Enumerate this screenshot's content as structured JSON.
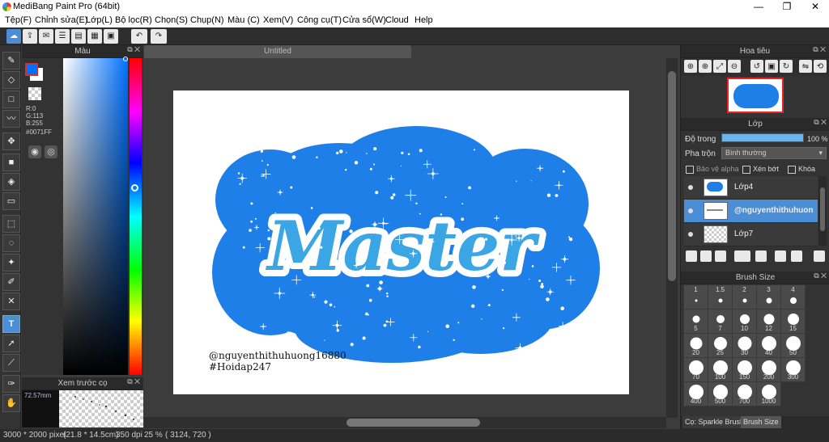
{
  "window": {
    "title": "MediBang Paint Pro (64bit)"
  },
  "menu": [
    "Tệp(F)",
    "Chỉnh sửa(E)",
    "Lớp(L)",
    "Bộ lọc(R)",
    "Chọn(S)",
    "Chụp(N)",
    "Màu (C)",
    "Xem(V)",
    "Công cụ(T)",
    "Cửa sổ(W)",
    "Cloud",
    "Help"
  ],
  "color_panel": {
    "title": "Màu",
    "rgb": {
      "r": "R:0",
      "g": "G:113",
      "b": "B:255"
    },
    "hex": "#0071FF",
    "fg_color": "#0071ff",
    "bg_color": "#ffffff"
  },
  "preview_panel": {
    "title": "Xem trước cọ",
    "size": "72.57mm"
  },
  "canvas": {
    "tab_title": "Untitled",
    "watermark_line1": "@nguyenthithuhuong16880",
    "watermark_line2": "#Hoidap247",
    "art_text": "Master",
    "cloud_color": "#1f7fe8"
  },
  "navigator": {
    "title": "Hoa tiêu"
  },
  "layer_panel": {
    "title": "Lớp",
    "opacity_label": "Độ trong",
    "opacity_value": "100 %",
    "opacity_fraction": 1.0,
    "blend_label": "Pha trộn",
    "blend_value": "Bình thường",
    "protect_alpha": "Bảo vệ alpha",
    "clipping": "Xén bớt",
    "lock": "Khóa",
    "layers": [
      {
        "name": "Lớp4",
        "selected": false
      },
      {
        "name": "@nguyenthithuhuong",
        "selected": true
      },
      {
        "name": "Lớp7",
        "selected": false
      }
    ]
  },
  "brush_size": {
    "title": "Brush Size",
    "sizes": [
      "1",
      "1.5",
      "2",
      "3",
      "4",
      "5",
      "7",
      "10",
      "12",
      "15",
      "20",
      "25",
      "30",
      "40",
      "50",
      "70",
      "100",
      "150",
      "200",
      "300",
      "400",
      "500",
      "700",
      "1000"
    ]
  },
  "bottom_tabs": {
    "brush": "Cọ: Sparkle Brush",
    "brush_size": "Brush Size"
  },
  "status": {
    "pixels": "3000 * 2000 pixel",
    "cm": "(21.8 * 14.5cm)",
    "dpi": "350 dpi",
    "zoom": "25 %",
    "coords": "( 3124, 720 )"
  }
}
